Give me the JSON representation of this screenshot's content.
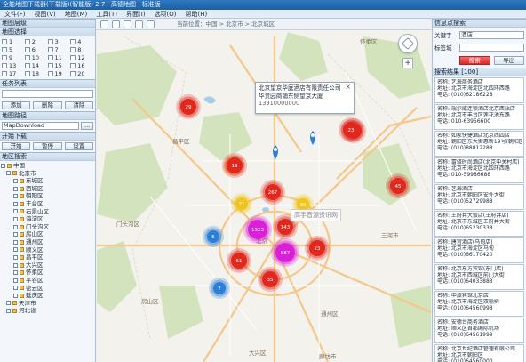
{
  "window": {
    "title": "全能地图下载器(下载版)(智能版) 2.7 · 高德地图 · 标准版"
  },
  "menu": [
    "文件(F)",
    "视图(V)",
    "地图(M)",
    "工具(T)",
    "界面(I)",
    "选项(O)",
    "帮助(H)"
  ],
  "left": {
    "sec_layers": "地图层级",
    "sec_map": "地图选择",
    "levels": [
      "1",
      "2",
      "3",
      "4",
      "5",
      "6",
      "7",
      "8",
      "9",
      "10",
      "11",
      "12",
      "13",
      "14",
      "15",
      "16",
      "17",
      "18",
      "19",
      "20"
    ],
    "sec_tasks": "任务列表",
    "task_value": "",
    "btn_add": "添加",
    "btn_del": "删除",
    "btn_clear": "清除",
    "sec_path": "地图路径",
    "path_value": "MapDownload",
    "btn_browse": "...",
    "sec_download": "开始下载",
    "btn_start": "开始",
    "btn_pause": "暂停",
    "btn_settings": "设置",
    "sec_region": "地区搜索",
    "tree": [
      "中国",
      "北京市",
      "东城区",
      "西城区",
      "朝阳区",
      "丰台区",
      "石景山区",
      "海淀区",
      "门头沟区",
      "房山区",
      "通州区",
      "顺义区",
      "昌平区",
      "大兴区",
      "怀柔区",
      "平谷区",
      "密云区",
      "延庆区",
      "天津市",
      "河北省"
    ]
  },
  "map": {
    "toolbar_coord": "当前位置：中国 > 北京市 > 北京城区",
    "popup": {
      "title": "北京望京华庭酒店有限责任公司",
      "address": "华贵园商铺东侧望京大厦",
      "phone": "13910000000"
    },
    "watermark": "高手音源资讯网",
    "cities": [
      {
        "text": "昌平区"
      },
      {
        "text": "顺义区"
      },
      {
        "text": "怀柔区"
      },
      {
        "text": "北京"
      },
      {
        "text": "通州区"
      },
      {
        "text": "大兴区"
      },
      {
        "text": "廊坊市"
      },
      {
        "text": "门头沟区"
      },
      {
        "text": "房山区"
      },
      {
        "text": "三河市"
      }
    ],
    "clusters": [
      {
        "kind": "red",
        "label": "29"
      },
      {
        "kind": "red",
        "label": "23"
      },
      {
        "kind": "red",
        "label": "19"
      },
      {
        "kind": "red",
        "label": "45"
      },
      {
        "kind": "red",
        "label": "21"
      },
      {
        "kind": "red",
        "label": "267"
      },
      {
        "kind": "red",
        "label": "143"
      },
      {
        "kind": "red",
        "label": "35"
      },
      {
        "kind": "red",
        "label": "61"
      },
      {
        "kind": "red",
        "label": "23"
      },
      {
        "kind": "magenta",
        "label": "1523"
      },
      {
        "kind": "magenta",
        "label": "887"
      },
      {
        "kind": "yellow",
        "label": "12"
      },
      {
        "kind": "yellow",
        "label": "21"
      },
      {
        "kind": "yellow",
        "label": "39"
      },
      {
        "kind": "blue",
        "label": "5"
      },
      {
        "kind": "blue",
        "label": "7"
      }
    ]
  },
  "right": {
    "sec_search": "信息点搜索",
    "keyword_label": "关键字",
    "keyword_value": "酒店",
    "area_label": "标签城",
    "area_value": "",
    "btn_search": "搜索",
    "btn_export": "导出",
    "sec_results": "搜索结果 [100]",
    "results": [
      {
        "name": "名称: 艺海商务酒店",
        "addr": "地址: 北京市海淀区北四环西路",
        "tel": "电话: (010)62186228"
      },
      {
        "name": "名称: 瑞尔威连锁酒店北京西站店",
        "addr": "地址: 北京市丰台区莲花池东路",
        "tel": "电话: 010-63956600"
      },
      {
        "name": "名称: 如家快捷酒店北京西四店",
        "addr": "地址: 朝阳区东大街惠新19号(朝阳区)",
        "tel": "电话: (010)88812288"
      },
      {
        "name": "名称: 富驿时尚酒店(北京中关村店)",
        "addr": "地址: 北京市海淀区北四环西路",
        "tel": "电话: 010-59986688"
      },
      {
        "name": "名称: 艺海酒店",
        "addr": "地址: 北京市朝阳区安外大街",
        "tel": "电话: (010)52729988"
      },
      {
        "name": "名称: 王府井大饭店(王府井店)",
        "addr": "地址: 北京市东城区王府井大街",
        "tel": "电话: (010)65230338"
      },
      {
        "name": "名称: 唐宫酒店(马甸店)",
        "addr": "地址: 北京市海淀区马甸",
        "tel": "电话: (010)66170420"
      },
      {
        "name": "名称: 北京东方宾馆(东门店)",
        "addr": "地址: 北京市西城区前门大街",
        "tel": "电话: (010)64033883"
      },
      {
        "name": "名称: 中旅宾馆北京店",
        "addr": "地址: 北京市海淀区双榆树",
        "tel": "电话: (010)64560998"
      },
      {
        "name": "名称: 安德台商务酒店",
        "addr": "地址: 顺义区首都国际机场",
        "tel": "电话: (010)64561999"
      },
      {
        "name": "名称: 北京世纪酒店管理有限公司",
        "addr": "地址: 北京市朝阳区",
        "tel": "电话: (010)64560000"
      }
    ]
  },
  "colors": {
    "title": "#1d5fa4",
    "cluster_red": "#e0281e",
    "cluster_magenta": "#d91fd8",
    "cluster_yellow": "#f0c419",
    "cluster_blue": "#2b7fd6",
    "search_btn": "#e23b3b"
  }
}
